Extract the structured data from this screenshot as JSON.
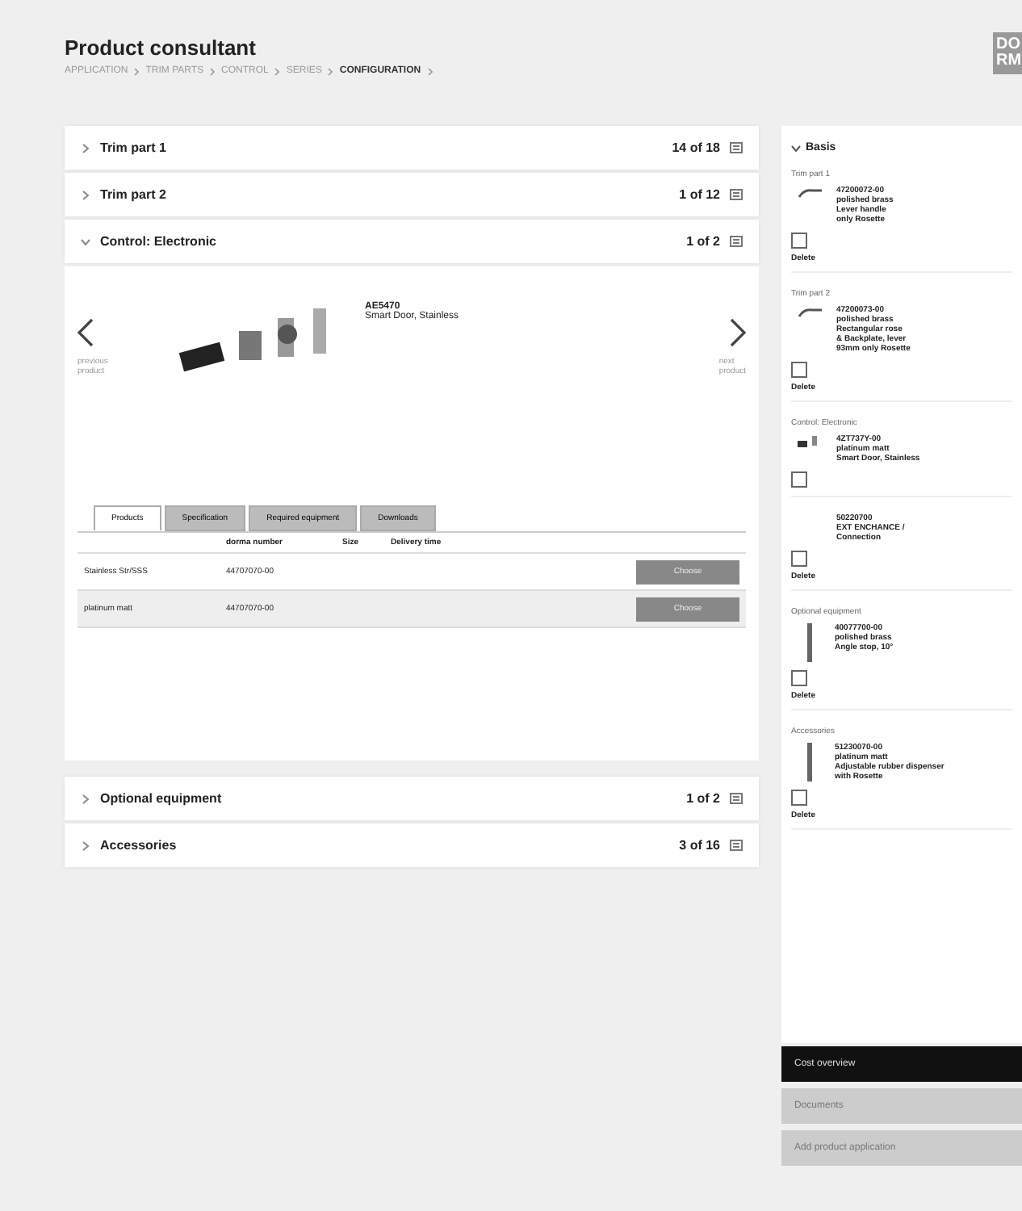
{
  "header": {
    "title": "Product consultant",
    "breadcrumb": [
      {
        "label": "APPLICATION",
        "selected": false
      },
      {
        "label": "TRIM PARTS",
        "selected": false
      },
      {
        "label": "CONTROL",
        "selected": false
      },
      {
        "label": "SERIES",
        "selected": false
      },
      {
        "label": "CONFIGURATION",
        "selected": true
      }
    ],
    "logo": [
      "DO",
      "RM"
    ]
  },
  "sections_top": [
    {
      "label": "Trim part 1",
      "count": "14 of 18",
      "expanded": false
    },
    {
      "label": "Trim part 2",
      "count": "1 of 12",
      "expanded": false
    },
    {
      "label": "Control: Electronic",
      "count": "1 of 2",
      "expanded": true
    }
  ],
  "product": {
    "code": "AE5470",
    "name": "Smart Door, Stainless",
    "prev": [
      "previous",
      "product"
    ],
    "next": [
      "next",
      "product"
    ]
  },
  "tabs": [
    {
      "label": "Products",
      "selected": true
    },
    {
      "label": "Specification",
      "selected": false
    },
    {
      "label": "Required equipment",
      "selected": false
    },
    {
      "label": "Downloads",
      "selected": false
    }
  ],
  "table": {
    "columns": [
      "",
      "dorma number",
      "Size",
      "Delivery time",
      ""
    ],
    "rows": [
      {
        "cells": [
          "Stainless Str/SSS",
          "44707070-00"
        ],
        "button": "Choose",
        "selected": false
      },
      {
        "cells": [
          "platinum matt",
          "44707070-00"
        ],
        "button": "Choose",
        "selected": true
      }
    ]
  },
  "sections_bottom": [
    {
      "label": "Optional equipment",
      "count": "1 of 2",
      "expanded": false
    },
    {
      "label": "Accessories",
      "count": "3 of 16",
      "expanded": false
    }
  ],
  "basket": {
    "title": "Basis",
    "groups": [
      {
        "label": "Trim part 1",
        "lines": [
          "47200072-00",
          "polished brass",
          "Lever handle",
          "only Rosette"
        ],
        "checked": false,
        "action": "Delete",
        "kind": "lever"
      },
      {
        "label": "Trim part 2",
        "lines": [
          "47200073-00",
          "polished brass",
          "Rectangular rose",
          "& Backplate, lever",
          "93mm only Rosette"
        ],
        "checked": false,
        "action": "Delete",
        "kind": "lever"
      },
      {
        "label": "Control: Electronic",
        "lines": [
          "4ZT737Y-00",
          "platinum matt",
          "Smart Door, Stainless"
        ],
        "checked": false,
        "kind": "card"
      },
      {
        "lines": [
          "50220700",
          "EXT ENCHANCE /",
          "Connection"
        ],
        "checked": false,
        "action": "Delete",
        "kind": "none"
      },
      {
        "label": "Optional equipment",
        "lines": [
          "40077700-00",
          "polished brass",
          "Angle stop, 10°"
        ],
        "checked": false,
        "action": "Delete",
        "kind": "bar"
      },
      {
        "label": "Accessories",
        "lines": [
          "51230070-00",
          "platinum matt",
          "Adjustable rubber dispenser",
          "with Rosette"
        ],
        "checked": false,
        "action": "Delete",
        "kind": "bar"
      }
    ],
    "buttons": [
      {
        "label": "Cost overview",
        "kind": "primary"
      },
      {
        "label": "Documents",
        "kind": "secondary"
      },
      {
        "label": "Add product application",
        "kind": "secondary"
      }
    ]
  }
}
